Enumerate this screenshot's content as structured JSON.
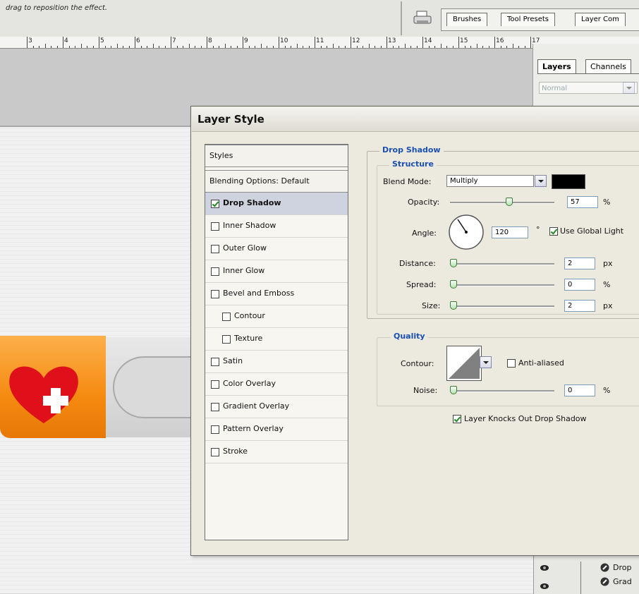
{
  "top": {
    "hint": "drag to reposition the effect.",
    "tabs": [
      "Brushes",
      "Tool Presets",
      "Layer Com"
    ]
  },
  "ruler": {
    "numbers": [
      "3",
      "4",
      "5",
      "6",
      "7",
      "8",
      "9",
      "10",
      "11",
      "12",
      "13",
      "14",
      "15",
      "16",
      "17"
    ]
  },
  "layers_panel": {
    "tabs": [
      "Layers",
      "Channels"
    ],
    "blend_mode": "Normal",
    "effects": [
      "Drop",
      "Grad"
    ]
  },
  "dialog": {
    "title": "Layer Style",
    "styles_list": {
      "header": "Styles",
      "blending": "Blending Options: Default",
      "items": [
        {
          "label": "Drop Shadow",
          "checked": true
        },
        {
          "label": "Inner Shadow",
          "checked": false
        },
        {
          "label": "Outer Glow",
          "checked": false
        },
        {
          "label": "Inner Glow",
          "checked": false
        },
        {
          "label": "Bevel and Emboss",
          "checked": false
        },
        {
          "label": "Contour",
          "checked": false
        },
        {
          "label": "Texture",
          "checked": false
        },
        {
          "label": "Satin",
          "checked": false
        },
        {
          "label": "Color Overlay",
          "checked": false
        },
        {
          "label": "Gradient Overlay",
          "checked": false
        },
        {
          "label": "Pattern Overlay",
          "checked": false
        },
        {
          "label": "Stroke",
          "checked": false
        }
      ]
    },
    "drop_shadow": {
      "title": "Drop Shadow",
      "structure_title": "Structure",
      "blend_mode_label": "Blend Mode:",
      "blend_mode_value": "Multiply",
      "shadow_color": "#000000",
      "opacity_label": "Opacity:",
      "opacity_value": "57",
      "opacity_unit": "%",
      "opacity_fraction": 0.57,
      "angle_label": "Angle:",
      "angle_value": "120",
      "angle_unit": "°",
      "global_light_label": "Use Global Light",
      "global_light_checked": true,
      "distance_label": "Distance:",
      "distance_value": "2",
      "distance_unit": "px",
      "spread_label": "Spread:",
      "spread_value": "0",
      "spread_unit": "%",
      "size_label": "Size:",
      "size_value": "2",
      "size_unit": "px"
    },
    "quality": {
      "title": "Quality",
      "contour_label": "Contour:",
      "anti_aliased_label": "Anti-aliased",
      "anti_aliased_checked": false,
      "noise_label": "Noise:",
      "noise_value": "0",
      "noise_unit": "%",
      "knocks_out_label": "Layer Knocks Out Drop Shadow",
      "knocks_out_checked": true
    }
  }
}
